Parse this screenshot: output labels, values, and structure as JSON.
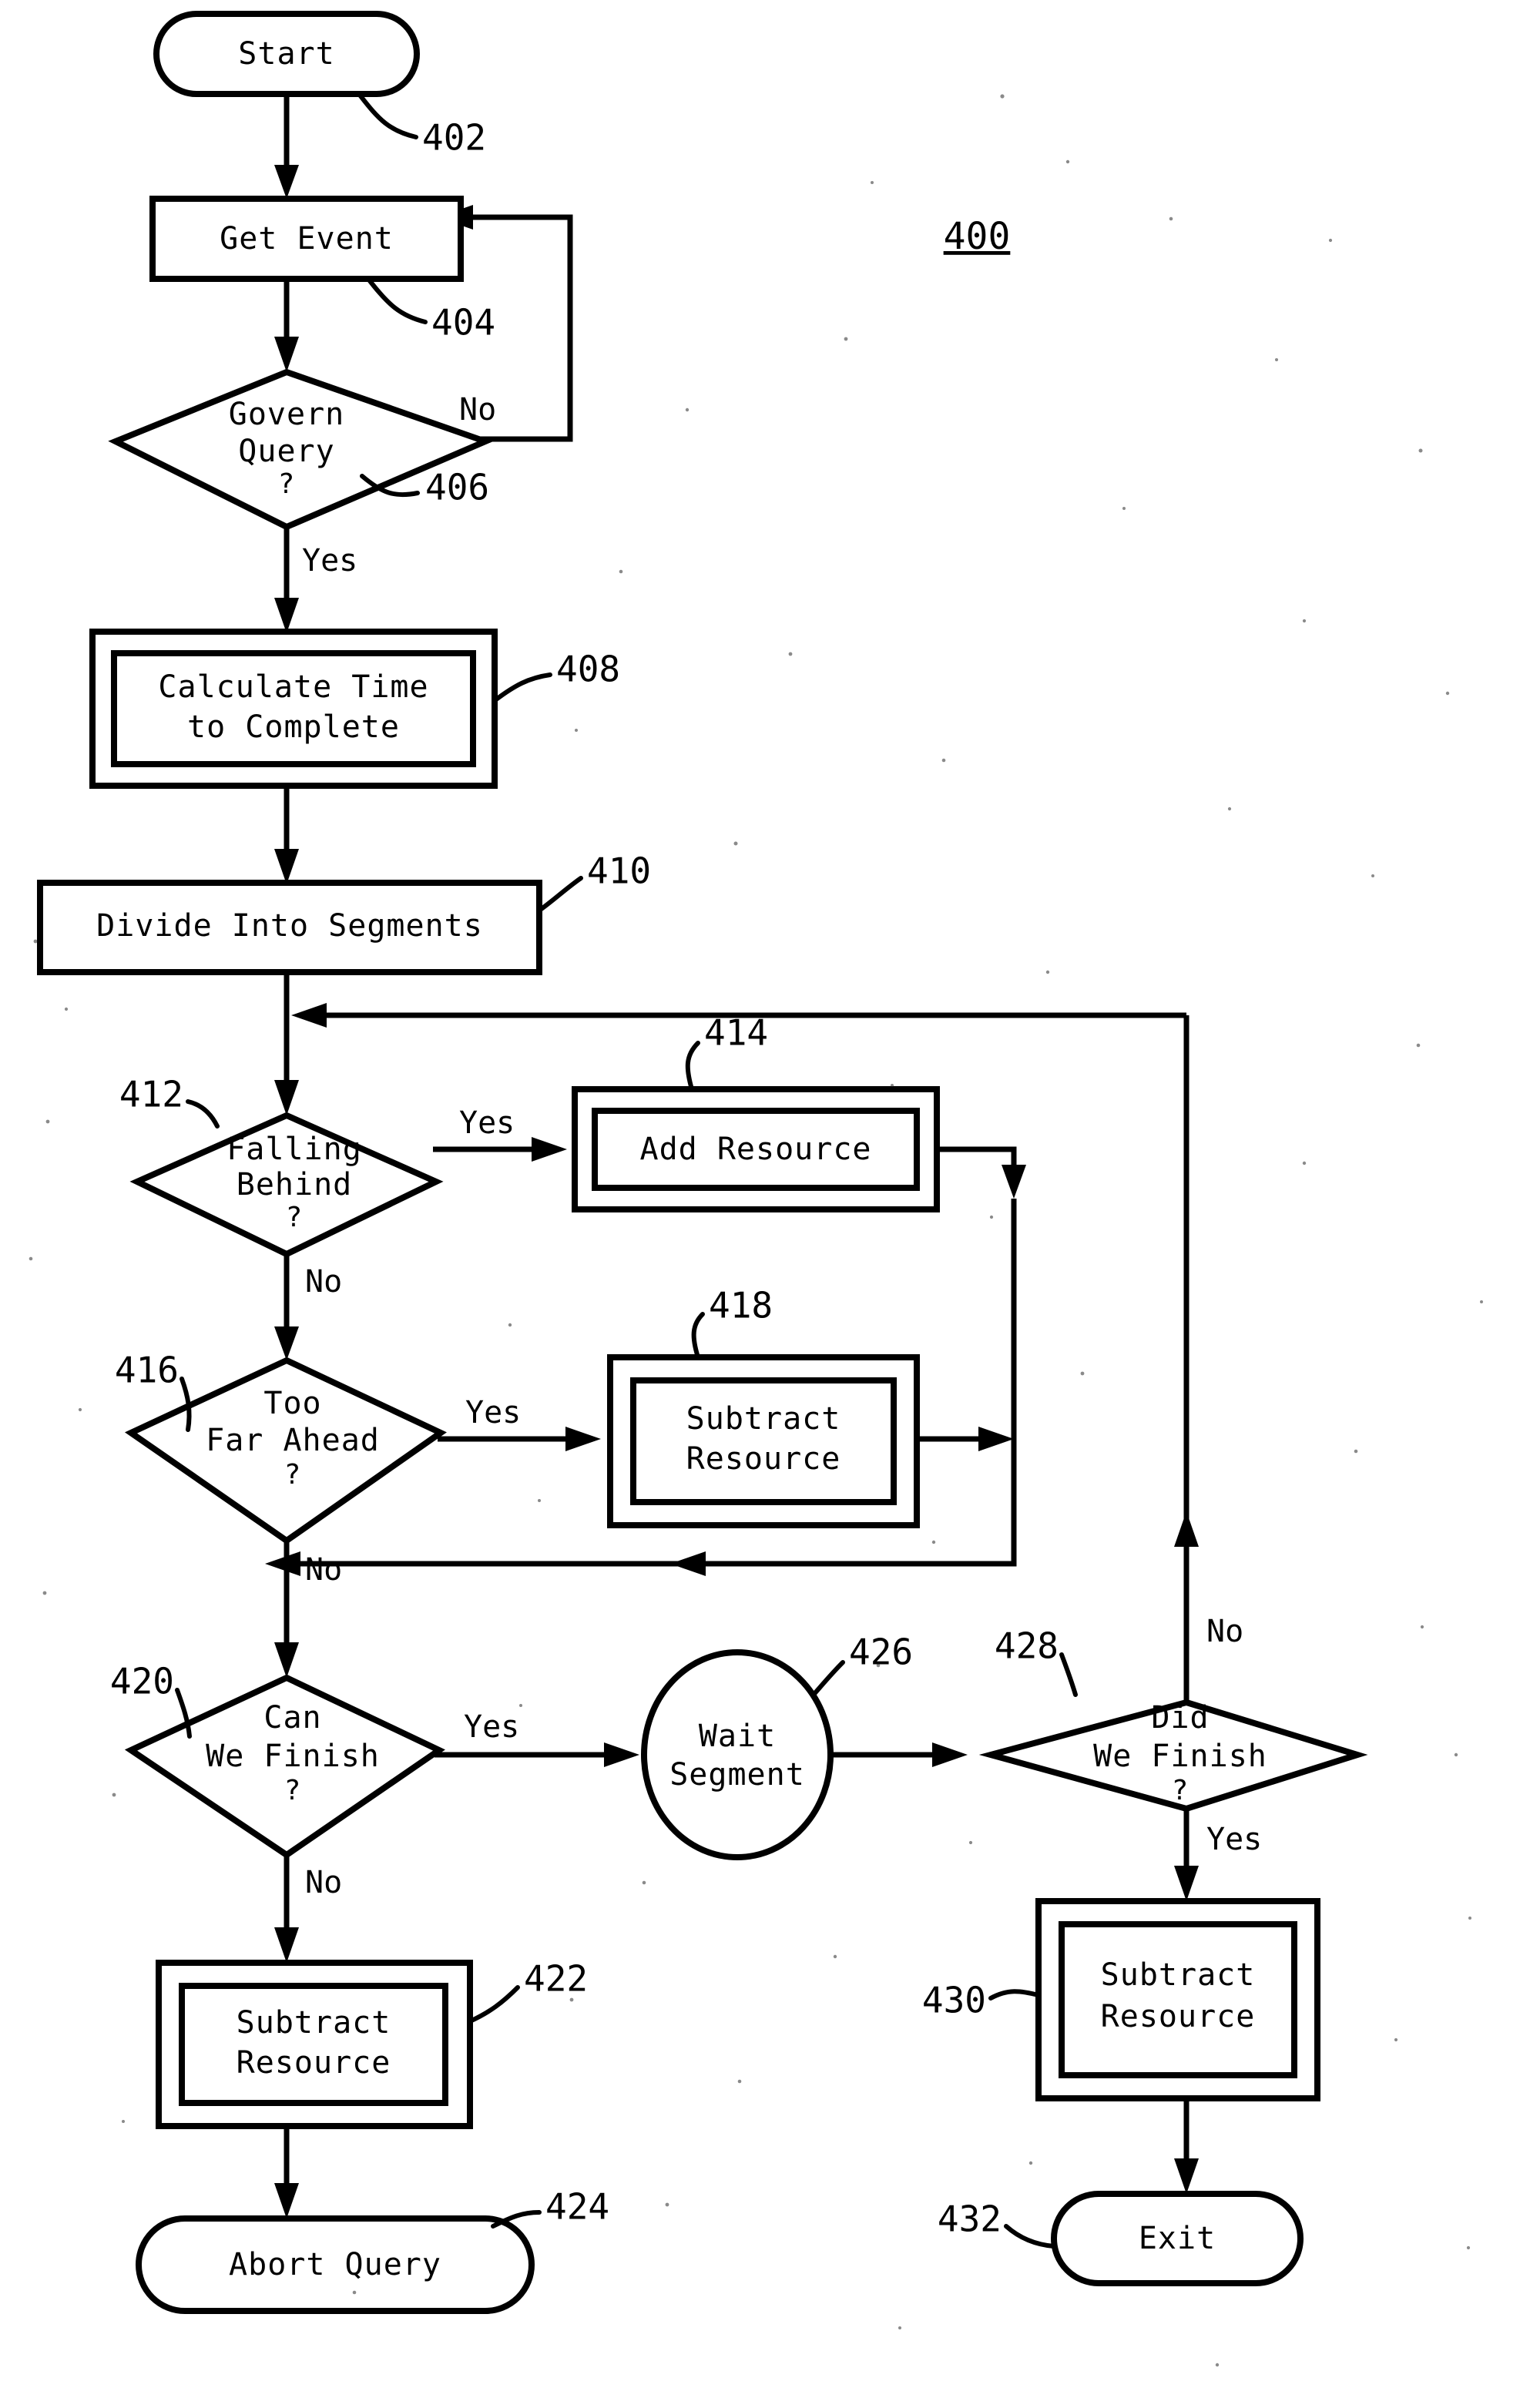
{
  "figure": {
    "number": "400",
    "domain": "patent-flowchart"
  },
  "nodes": [
    {
      "id": "402",
      "ref": "402",
      "shape": "terminator",
      "lines": [
        "Start"
      ]
    },
    {
      "id": "404",
      "ref": "404",
      "shape": "process",
      "lines": [
        "Get Event"
      ]
    },
    {
      "id": "406",
      "ref": "406",
      "shape": "decision",
      "lines": [
        "Govern",
        "Query",
        "?"
      ]
    },
    {
      "id": "408",
      "ref": "408",
      "shape": "predefined-process",
      "lines": [
        "Calculate Time",
        "to Complete"
      ]
    },
    {
      "id": "410",
      "ref": "410",
      "shape": "process",
      "lines": [
        "Divide Into Segments"
      ]
    },
    {
      "id": "412",
      "ref": "412",
      "shape": "decision",
      "lines": [
        "Falling",
        "Behind",
        "?"
      ]
    },
    {
      "id": "414",
      "ref": "414",
      "shape": "predefined-process",
      "lines": [
        "Add Resource"
      ]
    },
    {
      "id": "416",
      "ref": "416",
      "shape": "decision",
      "lines": [
        "Too",
        "Far Ahead",
        "?"
      ]
    },
    {
      "id": "418",
      "ref": "418",
      "shape": "predefined-process",
      "lines": [
        "Subtract",
        "Resource"
      ]
    },
    {
      "id": "420",
      "ref": "420",
      "shape": "decision",
      "lines": [
        "Can",
        "We Finish",
        "?"
      ]
    },
    {
      "id": "422",
      "ref": "422",
      "shape": "predefined-process",
      "lines": [
        "Subtract",
        "Resource"
      ]
    },
    {
      "id": "424",
      "ref": "424",
      "shape": "terminator",
      "lines": [
        "Abort Query"
      ]
    },
    {
      "id": "426",
      "ref": "426",
      "shape": "circle",
      "lines": [
        "Wait",
        "Segment"
      ]
    },
    {
      "id": "428",
      "ref": "428",
      "shape": "decision",
      "lines": [
        "Did",
        "We Finish",
        "?"
      ]
    },
    {
      "id": "430",
      "ref": "430",
      "shape": "predefined-process",
      "lines": [
        "Subtract",
        "Resource"
      ]
    },
    {
      "id": "432",
      "ref": "432",
      "shape": "terminator",
      "lines": [
        "Exit"
      ]
    }
  ],
  "edge_labels": {
    "govern_no": "No",
    "govern_yes": "Yes",
    "falling_yes": "Yes",
    "falling_no": "No",
    "toofar_yes": "Yes",
    "toofar_no": "No",
    "canfinish_yes": "Yes",
    "canfinish_no": "No",
    "didfinish_no": "No",
    "didfinish_yes": "Yes"
  },
  "text": {
    "start": "Start",
    "get_event": "Get Event",
    "govern_l1": "Govern",
    "govern_l2": "Query",
    "govern_l3": "?",
    "calc_l1": "Calculate Time",
    "calc_l2": "to Complete",
    "divide": "Divide Into Segments",
    "falling_l1": "Falling",
    "falling_l2": "Behind",
    "falling_l3": "?",
    "add_resource": "Add Resource",
    "toofar_l1": "Too",
    "toofar_l2": "Far Ahead",
    "toofar_l3": "?",
    "subtract_418_l1": "Subtract",
    "subtract_418_l2": "Resource",
    "canfinish_l1": "Can",
    "canfinish_l2": "We Finish",
    "canfinish_l3": "?",
    "subtract_422_l1": "Subtract",
    "subtract_422_l2": "Resource",
    "abort_query": "Abort Query",
    "wait_l1": "Wait",
    "wait_l2": "Segment",
    "didfinish_l1": "Did",
    "didfinish_l2": "We Finish",
    "didfinish_l3": "?",
    "subtract_430_l1": "Subtract",
    "subtract_430_l2": "Resource",
    "exit": "Exit",
    "fig_number": "400",
    "ref_402": "402",
    "ref_404": "404",
    "ref_406": "406",
    "ref_408": "408",
    "ref_410": "410",
    "ref_412": "412",
    "ref_414": "414",
    "ref_416": "416",
    "ref_418": "418",
    "ref_420": "420",
    "ref_422": "422",
    "ref_424": "424",
    "ref_426": "426",
    "ref_428": "428",
    "ref_430": "430",
    "ref_432": "432",
    "lbl_no_1": "No",
    "lbl_yes_1": "Yes",
    "lbl_yes_2": "Yes",
    "lbl_no_2": "No",
    "lbl_yes_3": "Yes",
    "lbl_no_3": "No",
    "lbl_yes_4": "Yes",
    "lbl_no_4": "No",
    "lbl_no_5": "No",
    "lbl_yes_5": "Yes"
  },
  "colors": {
    "ink": "#000000",
    "paper": "#ffffff"
  }
}
